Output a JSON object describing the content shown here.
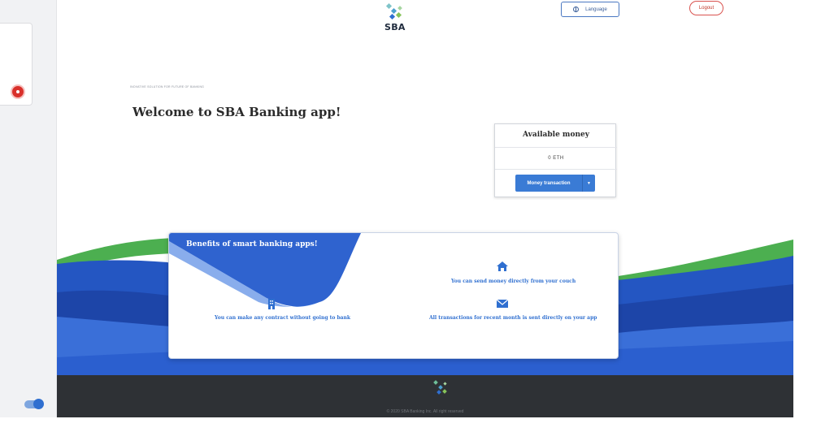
{
  "header": {
    "logo_text": "SBA",
    "language_label": "Language",
    "logout_label": "Logout"
  },
  "hero": {
    "tagline": "INOVATIVE SOLUTION FOR FUTURE OF BANKING",
    "welcome": "Welcome to SBA Banking app!"
  },
  "money": {
    "title": "Available money",
    "amount": "0 ETH",
    "transaction_label": "Money transaction"
  },
  "benefits": {
    "title": "Benefits of smart banking apps!",
    "items": [
      {
        "icon": "building-icon",
        "text": "You can make any contract without going to bank"
      },
      {
        "icon": "home-icon",
        "text": "You can send money directly from your couch"
      },
      {
        "icon": "envelope-icon",
        "text": "All transactions for recent month is sent directly on your app"
      }
    ]
  },
  "footer": {
    "copyright": "© 2020 SBA Banking Inc. All right reserved"
  },
  "colors": {
    "primary": "#3a7bd5",
    "wave_dark": "#1f4fb5",
    "wave_green": "#4caf50",
    "footer_bg": "#2e3135",
    "logout": "#d9534f"
  }
}
